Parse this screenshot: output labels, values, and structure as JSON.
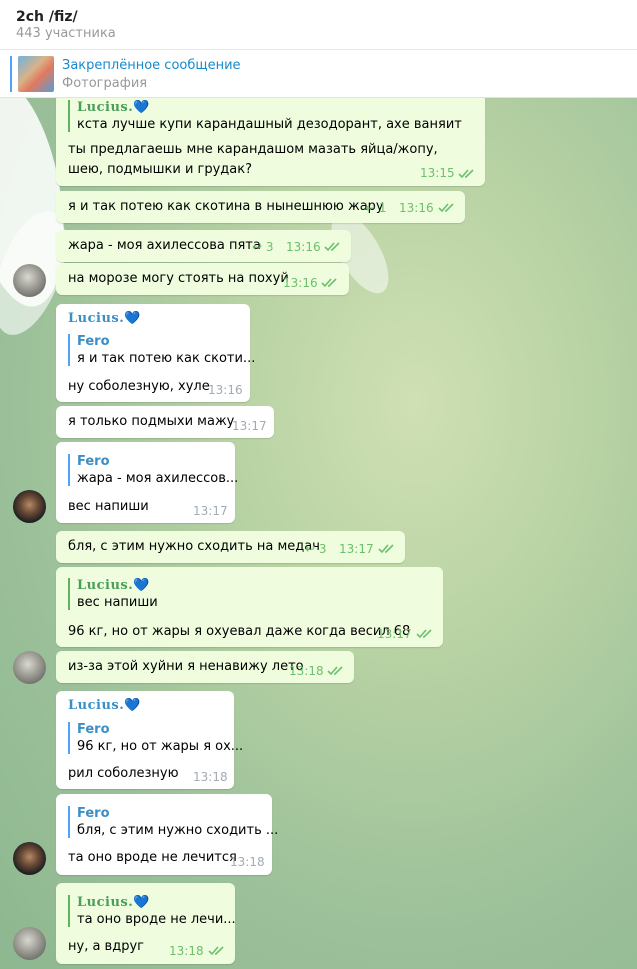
{
  "header": {
    "title": "2ch /fiz/",
    "subtitle": "443 участника"
  },
  "pinned": {
    "title": "Закреплённое сообщение",
    "subtitle": "Фотография"
  },
  "names": {
    "lucius": "Lucius.",
    "heart": "💙",
    "fero": "Fero"
  },
  "messages": {
    "m1": {
      "quote_text": "кста лучше купи карандашный дезодорант, ахе ваняит",
      "text": "ты предлагаешь мне карандашом мазать яйца/жопу, шею, подмышки и грудак?",
      "time": "13:15"
    },
    "m2": {
      "text": "я и так потею как скотина в нынешнюю жару",
      "replies": "1",
      "time": "13:16"
    },
    "m3": {
      "text": "жара - моя ахилессова пята",
      "replies": "3",
      "time": "13:16"
    },
    "m4": {
      "text": "на морозе могу стоять на похуй",
      "time": "13:16"
    },
    "m5": {
      "quote_text": "я и так потею как скоти...",
      "text": "ну соболезную, хуле",
      "time": "13:16"
    },
    "m6": {
      "text": "я только подмыхи мажу",
      "time": "13:17"
    },
    "m7": {
      "quote_text": "жара - моя ахилессов...",
      "text": "вес напиши",
      "time": "13:17"
    },
    "m8": {
      "text": "бля, с этим нужно сходить на медач",
      "replies": "3",
      "time": "13:17"
    },
    "m9": {
      "quote_text": "вес напиши",
      "text": "96 кг, но от жары я охуевал даже когда весил 68",
      "time": "13:17"
    },
    "m10": {
      "text": "из-за этой хуйни я ненавижу лето",
      "time": "13:18"
    },
    "m11": {
      "quote_text": "96 кг, но от жары я ох...",
      "text": "рил соболезную",
      "time": "13:18"
    },
    "m12": {
      "quote_text": "бля, с этим нужно сходить ...",
      "text": "та оно вроде не лечится",
      "time": "13:18"
    },
    "m13": {
      "quote_text": "та оно вроде не лечи...",
      "text": "ну, а вдруг",
      "time": "13:18"
    }
  },
  "icons": {
    "read": "double-check-icon",
    "reply": "reply-arrow-icon"
  },
  "colors": {
    "accent": "#168acd",
    "outgoing_bubble": "#effdde",
    "incoming_bubble": "#ffffff",
    "check": "#6cbf6c"
  }
}
